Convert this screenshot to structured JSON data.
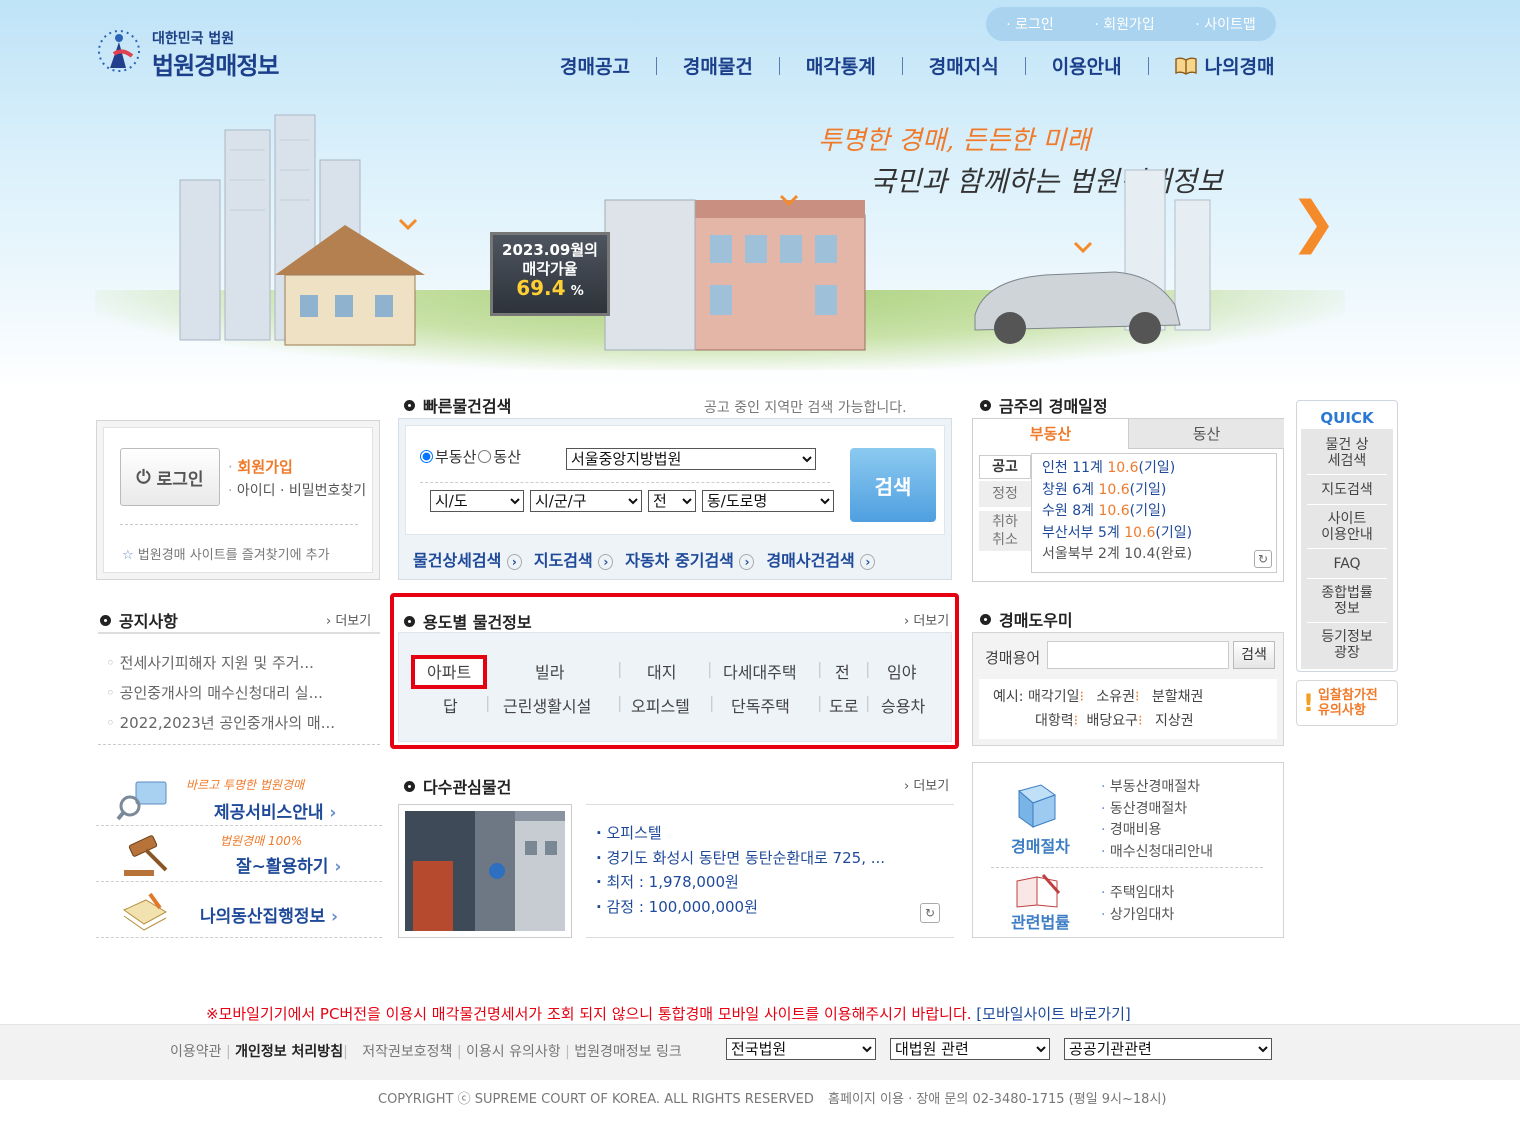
{
  "header": {
    "logo_small": "대한민국 법원",
    "logo_big": "법원경매정보",
    "util_links": [
      "· 로그인",
      "· 회원가입",
      "· 사이트맵"
    ],
    "nav": [
      "경매공고",
      "경매물건",
      "매각통계",
      "경매지식",
      "이용안내",
      "나의경매"
    ],
    "slogan1": "투명한 경매, 든든한 미래",
    "slogan2": "국민과 함께하는 법원경매정보",
    "billboard_line1": "2023.09월의",
    "billboard_line2": "매각가율",
    "billboard_value": "69.4",
    "billboard_unit": "%"
  },
  "login": {
    "login_button": "로그인",
    "join": "회원가입",
    "find": "아이디 · 비밀번호찾기",
    "favorite": "법원경매 사이트를 즐겨찾기에 추가"
  },
  "quick_search": {
    "title": "빠른물건검색",
    "notice": "공고 중인 지역만 검색 가능합니다.",
    "radio_realestate": "부동산",
    "radio_movable": "동산",
    "court": "서울중앙지방법원",
    "sido": "시/도",
    "sigungu": "시/군/구",
    "jeon": "전",
    "dong": "동/도로명",
    "search_button": "검색",
    "links": [
      "물건상세검색",
      "지도검색",
      "자동차 중기검색",
      "경매사건검색"
    ]
  },
  "schedule": {
    "title": "금주의 경매일정",
    "tab_realestate": "부동산",
    "tab_movable": "동산",
    "side": [
      "공고",
      "정정",
      "취하 취소"
    ],
    "items": [
      {
        "text": "인천 11계",
        "date": "10.6",
        "status": "(기일)"
      },
      {
        "text": "창원 6계",
        "date": "10.6",
        "status": "(기일)"
      },
      {
        "text": "수원 8계",
        "date": "10.6",
        "status": "(기일)"
      },
      {
        "text": "부산서부 5계",
        "date": "10.6",
        "status": "(기일)"
      },
      {
        "text": "서울북부 2계",
        "date": "10.4",
        "status": "(완료)"
      }
    ]
  },
  "quick": {
    "title": "QUICK",
    "items": [
      "물건 상세검색",
      "지도검색",
      "사이트 이용안내",
      "FAQ",
      "종합법률 정보",
      "등기정보 광장"
    ],
    "caution": "입찰참가전 유의사항"
  },
  "notice": {
    "title": "공지사항",
    "more": "더보기",
    "items": [
      "전세사기피해자 지원 및 주거...",
      "공인중개사의 매수신청대리 실...",
      "2022,2023년 공인중개사의 매..."
    ]
  },
  "usage": {
    "title": "용도별 물건정보",
    "more": "더보기",
    "row1": [
      "아파트",
      "빌라",
      "대지",
      "다세대주택",
      "전",
      "임야"
    ],
    "row2": [
      "답",
      "근린생활시설",
      "오피스텔",
      "단독주택",
      "도로",
      "승용차"
    ]
  },
  "helper": {
    "title": "경매도우미",
    "label": "경매용어",
    "input_value": "",
    "button": "검색",
    "example_label": "예시:",
    "examples": [
      "매각기일",
      "소유권",
      "분할채권",
      "대항력",
      "배당요구",
      "지상권"
    ]
  },
  "services": [
    {
      "sub": "바르고 투명한 법원경매",
      "main": "제공서비스안내"
    },
    {
      "sub": "법원경매 100%",
      "main": "잘~활용하기"
    },
    {
      "sub": "",
      "main": "나의동산집행정보"
    }
  ],
  "interest": {
    "title": "다수관심물건",
    "more": "더보기",
    "lines": [
      "오피스텔",
      "경기도 화성시 동탄면 동탄순환대로 725, ...",
      "최저 : 1,978,000원",
      "감정 : 100,000,000원"
    ]
  },
  "procedure": {
    "label1": "경매절차",
    "links1": [
      "부동산경매절차",
      "동산경매절차",
      "경매비용",
      "매수신청대리안내"
    ],
    "label2": "관련법률",
    "links2": [
      "주택임대차",
      "상가임대차"
    ]
  },
  "footer": {
    "mobile_notice": "※모바일기기에서 PC버전을 이용시 매각물건명세서가 조회 되지 않으니 통합경매 모바일 사이트를 이용해주시기 바랍니다.",
    "mobile_link": "[모바일사이트 바로가기]",
    "links": [
      "이용약관",
      "개인정보 처리방침",
      "저작권보호정책",
      "이용시 유의사항",
      "법원경매정보 링크"
    ],
    "select1": "전국법원",
    "select2": "대법원 관련",
    "select3": "공공기관관련",
    "copyright": "COPYRIGHT ⓒ SUPREME COURT OF KOREA. ALL RIGHTS RESERVED",
    "contact": "홈페이지 이용 · 장애 문의 02-3480-1715 (평일 9시~18시)"
  },
  "colors": {
    "accent_red": "#e50012",
    "brand_blue": "#1b3f8a",
    "orange": "#f07a2a"
  }
}
